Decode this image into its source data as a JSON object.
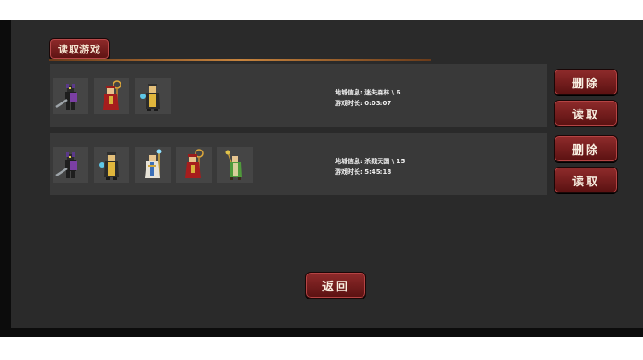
{
  "title_tab": "读取游戏",
  "saves": [
    {
      "location_label": "地城信息:",
      "location_value": "迷失森林 \\ 6",
      "time_label": "游戏时长:",
      "time_value": "0:03:07",
      "heroes": [
        "dark-knight-icon",
        "fire-mage-icon",
        "ice-monk-icon"
      ],
      "delete_label": "删除",
      "load_label": "读取"
    },
    {
      "location_label": "地城信息:",
      "location_value": "杀戮天国 \\ 15",
      "time_label": "游戏时长:",
      "time_value": "5:45:18",
      "heroes": [
        "dark-knight-icon",
        "ice-monk-icon",
        "priest-icon",
        "fire-mage-icon",
        "druid-icon"
      ],
      "delete_label": "删除",
      "load_label": "读取"
    }
  ],
  "back_label": "返回",
  "colors": {
    "background": "#2a2a2a",
    "card": "#393939",
    "button_red": "#7a1f1f",
    "accent_line": "#c7843e"
  }
}
